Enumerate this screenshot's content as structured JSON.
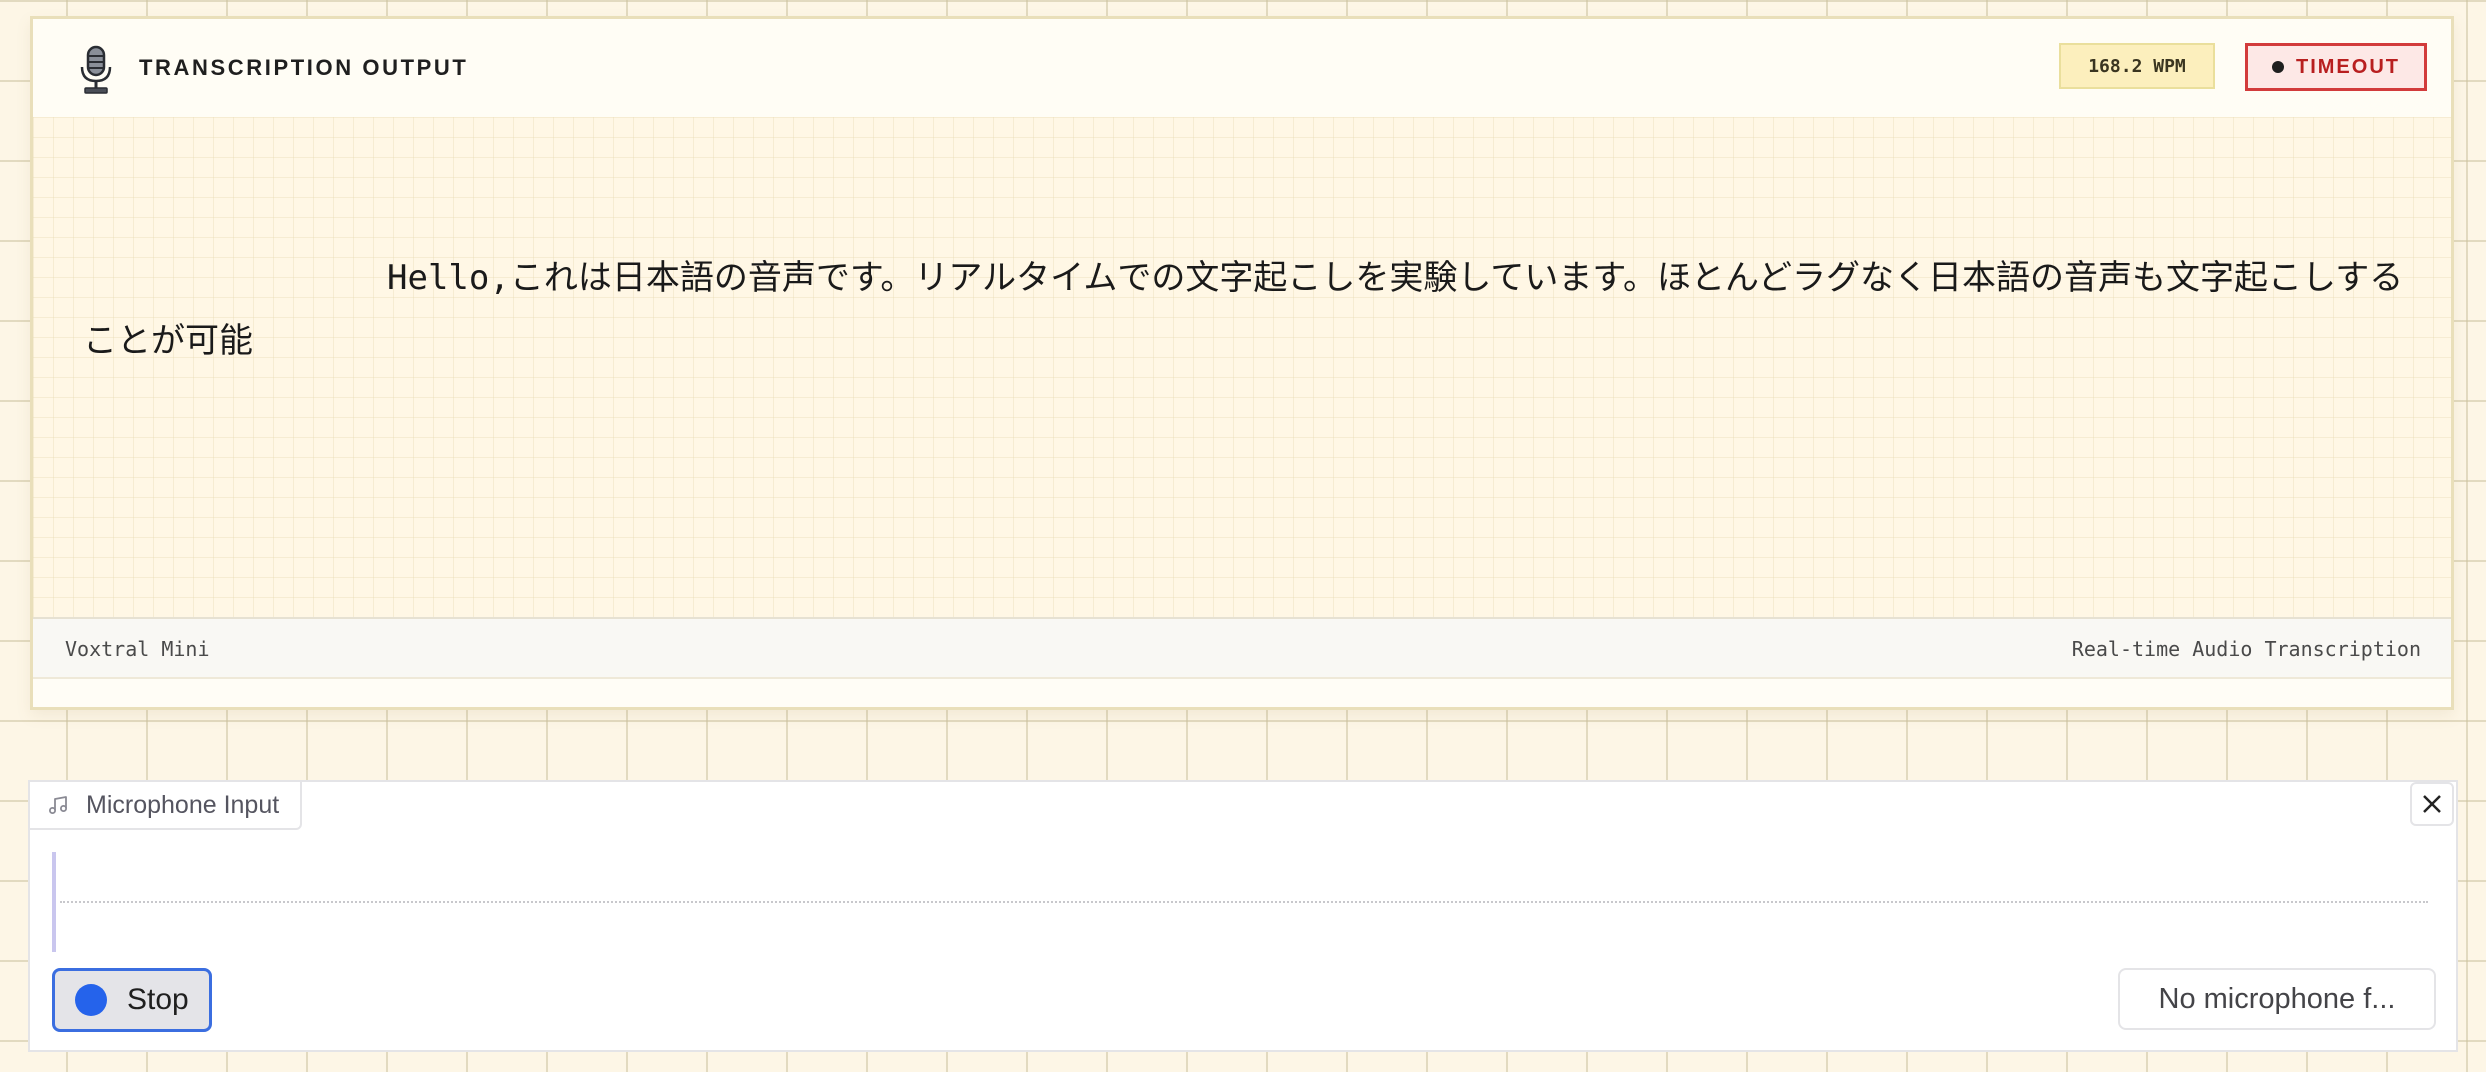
{
  "transcription": {
    "title": "TRANSCRIPTION OUTPUT",
    "wpm": "168.2 WPM",
    "status": "TIMEOUT",
    "text": "Hello,これは日本語の音声です。リアルタイムでの文字起こしを実験しています。ほとんどラグなく日本語の音声も文字起こしすることが可能",
    "footer_left": "Voxtral Mini",
    "footer_right": "Real-time Audio Transcription",
    "icon": "microphone-icon"
  },
  "microphone": {
    "tab_label": "Microphone Input",
    "tab_icon": "music-note-icon",
    "stop_label": "Stop",
    "device_value": "No microphone f...",
    "close_icon": "close-icon"
  },
  "colors": {
    "accent": "#2563eb",
    "timeout": "#d23b3b",
    "wpm_bg": "#fcefbd",
    "background": "#fdf6e6"
  }
}
